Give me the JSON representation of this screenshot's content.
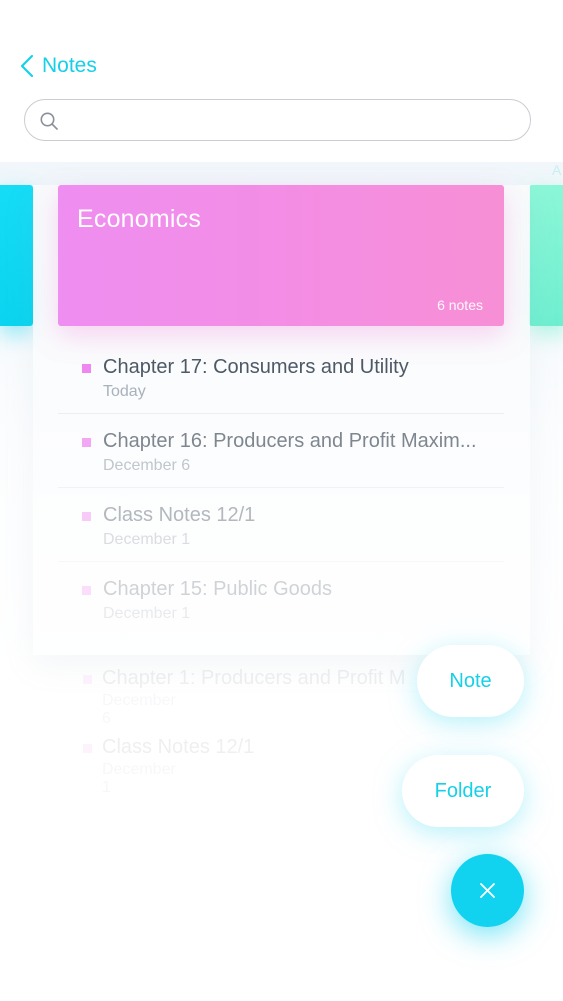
{
  "header": {
    "back_label": "Notes"
  },
  "search": {
    "placeholder": "",
    "value": ""
  },
  "carousel": {
    "right_peek_text": "A",
    "folder": {
      "title": "Economics",
      "count_label": "6 notes",
      "color": "#f38de5"
    },
    "left_color": "#16dcf6",
    "right_color": "#8cf7d8"
  },
  "notes": [
    {
      "title": "Chapter 17: Consumers and Utility",
      "date": "Today"
    },
    {
      "title": "Chapter 16: Producers and Profit Maxim...",
      "date": "December 6"
    },
    {
      "title": "Class Notes 12/1",
      "date": "December 1"
    },
    {
      "title": "Chapter 15: Public Goods",
      "date": "December 1"
    }
  ],
  "ghost_notes": [
    {
      "title": "Chapter 1: Producers and Profit M",
      "date": "December 6"
    },
    {
      "title": "Class Notes 12/1",
      "date": "December 1"
    }
  ],
  "fab": {
    "note_label": "Note",
    "folder_label": "Folder",
    "accent": "#11d3ef",
    "close_icon": "close-icon"
  }
}
